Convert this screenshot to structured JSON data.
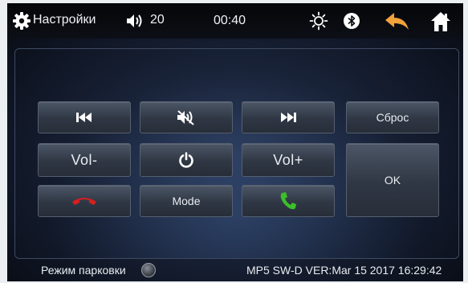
{
  "header": {
    "title": "Настройки",
    "volume": "20",
    "clock": "00:40",
    "icons": [
      "gear-icon",
      "speaker-icon",
      "brightness-icon",
      "bluetooth-icon",
      "back-arrow-icon",
      "home-icon"
    ]
  },
  "controls": {
    "prev_icon": "previous-track-icon",
    "mute_icon": "mute-icon",
    "next_icon": "next-track-icon",
    "reset_label": "Сброс",
    "vol_down_label": "Vol-",
    "power_icon": "power-icon",
    "vol_up_label": "Vol+",
    "ok_label": "OK",
    "hangup_icon": "hang-up-icon",
    "mode_label": "Mode",
    "call_icon": "call-icon"
  },
  "footer": {
    "parking_label": "Режим парковки",
    "parking_on": false,
    "version": "MP5 SW-D VER:Mar 15 2017 16:29:42"
  },
  "colors": {
    "back_arrow": "#f2a23a",
    "hangup": "#d81e1e",
    "call": "#3cbf2a"
  }
}
